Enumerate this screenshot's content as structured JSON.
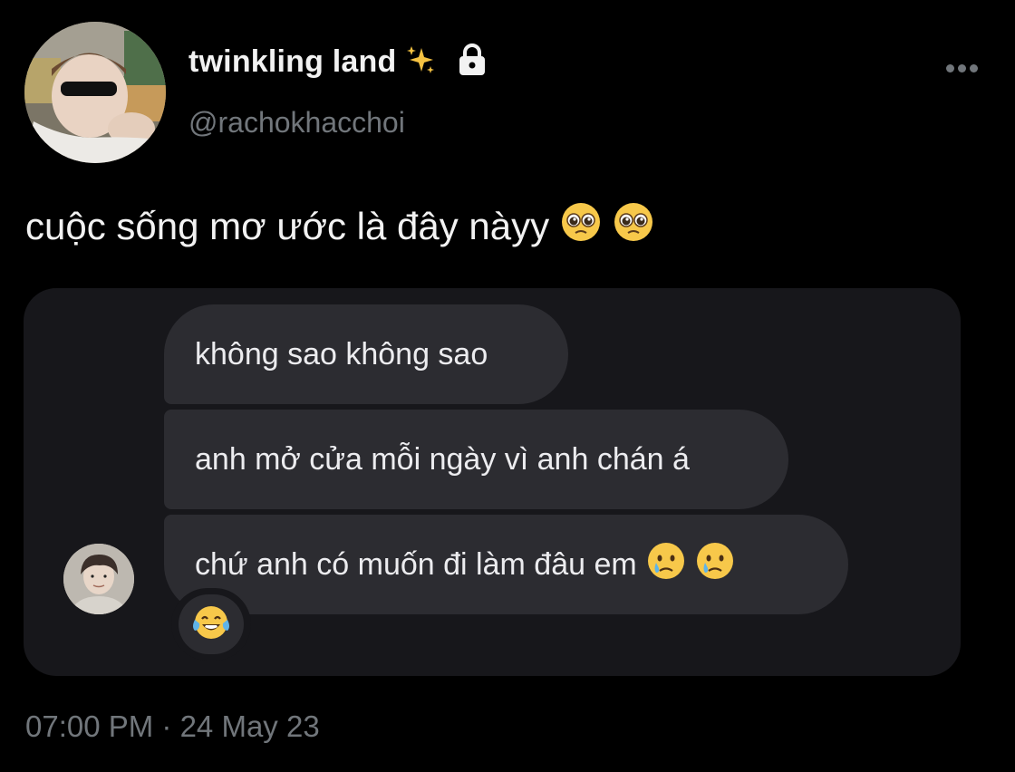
{
  "tweet": {
    "display_name": "twinkling land",
    "handle": "@rachokhacchoi",
    "text": "cuộc sống mơ ước là đây nàyy",
    "text_emojis": [
      "pleading-face",
      "pleading-face"
    ],
    "timestamp": "07:00 PM · 24 May 23",
    "icons": {
      "name_badge": "sparkles-icon",
      "protected": "lock-icon",
      "menu": "more-options-icon"
    }
  },
  "chat": {
    "messages": [
      {
        "text": "không sao không sao"
      },
      {
        "text": "anh mở cửa mỗi ngày vì anh chán á"
      },
      {
        "text": "chứ anh có muốn đi làm đâu em",
        "emojis": [
          "sad-tear-face",
          "sad-tear-face"
        ]
      }
    ],
    "reaction": "laughing-tears-face"
  },
  "colors": {
    "background": "#000000",
    "text_primary": "#e7e9ea",
    "text_secondary": "#71767b",
    "chat_card": "#17171b",
    "bubble": "#2c2c31"
  }
}
